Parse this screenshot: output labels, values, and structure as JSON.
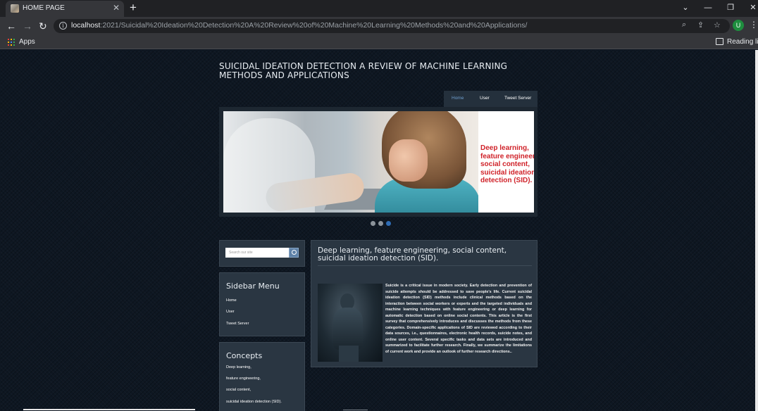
{
  "browser": {
    "tab_title": "HOME PAGE",
    "tab_close": "✕",
    "new_tab": "+",
    "url_host": "localhost",
    "url_path": ":2021/Suicidal%20Ideation%20Detection%20A%20Review%20of%20Machine%20Learning%20Methods%20and%20Applications/",
    "avatar_letter": "U",
    "bookmarks_apps": "Apps",
    "reading_list": "Reading list"
  },
  "site": {
    "title": "SUICIDAL IDEATION DETECTION A REVIEW OF MACHINE LEARNING METHODS AND APPLICATIONS",
    "nav": [
      "Home",
      "User",
      "Tweet Server"
    ],
    "active_nav": "Home"
  },
  "slider": {
    "caption": "Deep learning, feature engineering, social content, suicidal ideation detection (SID).",
    "dot_count": 3,
    "active_dot": 3
  },
  "search": {
    "placeholder": "Search our site"
  },
  "sidebar_menu": {
    "heading": "Sidebar Menu",
    "items": [
      "Home",
      "User",
      "Tweet Server"
    ]
  },
  "concepts": {
    "heading": "Concepts",
    "items": [
      "Deep learning,",
      "feature engineering,",
      "social content,",
      "suicidal ideation detection (SID)."
    ]
  },
  "main": {
    "heading": "Deep learning, feature engineering, social content, suicidal ideation detection (SID).",
    "body": "Suicide is a critical issue in modern society. Early detection and prevention of suicide attempts should be addressed to save people's life. Current suicidal ideation detection (SID) methods include clinical methods based on the interaction between social workers or experts and the targeted individuals and machine learning techniques with feature engineering or deep learning for automatic detection based on online social contents. This article is the first survey that comprehensively introduces and discusses the methods from these categories. Domain-specific applications of SID are reviewed according to their data sources, i.e., questionnaires, electronic health records, suicide notes, and online user content. Several specific tasks and data sets are introduced and summarized to facilitate further research. Finally, we summarize the limitations of current work and provide an outlook of further research directions.."
  }
}
